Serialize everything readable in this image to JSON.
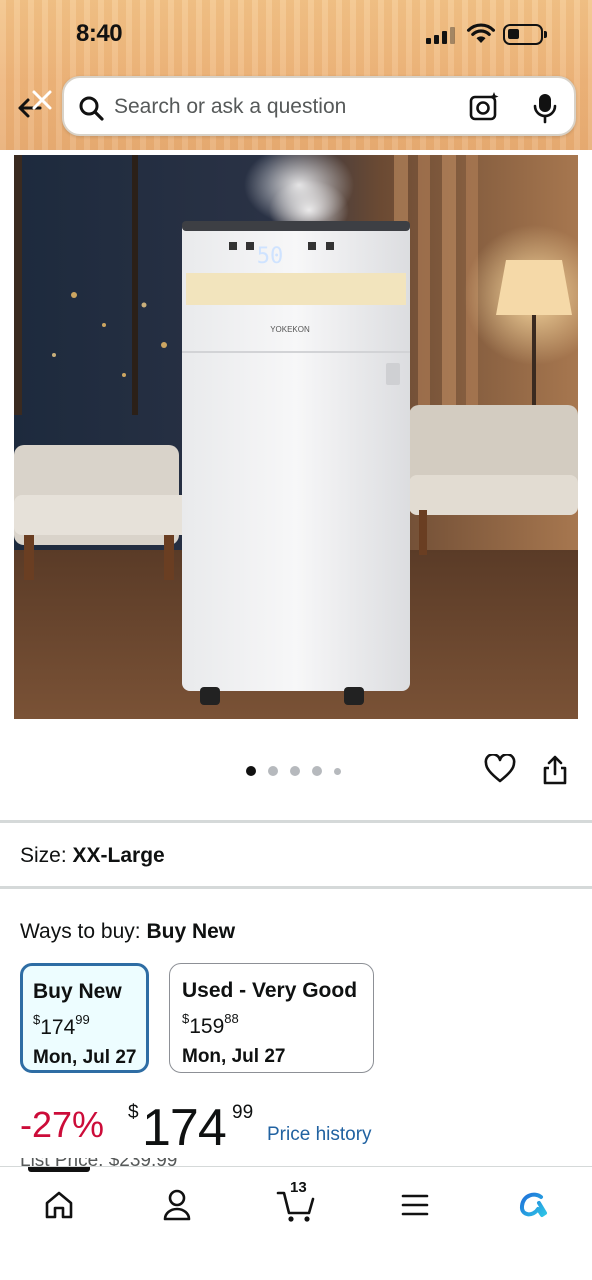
{
  "status_bar": {
    "time": "8:40"
  },
  "search": {
    "placeholder": "Search or ask a question"
  },
  "product": {
    "brand_on_image": "YOKEKON",
    "display_value": "50",
    "image_count": 5,
    "active_image_index": 0
  },
  "size": {
    "label": "Size:",
    "value": "XX-Large"
  },
  "ways_to_buy": {
    "label": "Ways to buy:",
    "selected": "Buy New",
    "options": [
      {
        "title": "Buy New",
        "price_symbol": "$",
        "price_whole": "174",
        "price_cents": "99",
        "date": "Mon, Jul 27",
        "selected": true
      },
      {
        "title": "Used - Very Good",
        "price_symbol": "$",
        "price_whole": "159",
        "price_cents": "88",
        "date": "Mon, Jul 27",
        "selected": false
      }
    ]
  },
  "price": {
    "discount": "-27%",
    "symbol": "$",
    "whole": "174",
    "cents": "99",
    "history_link": "Price history",
    "list_price_text": "List Price: $239.99"
  },
  "bottom_nav": {
    "cart_count": "13",
    "items": [
      "home",
      "account",
      "cart",
      "menu",
      "rufus"
    ],
    "active": "home"
  },
  "colors": {
    "header_bg": "#eeb57b",
    "discount_red": "#cc0c39",
    "link_blue": "#2162a1",
    "selected_border": "#2e6da4",
    "selected_bg": "#edfdff"
  }
}
